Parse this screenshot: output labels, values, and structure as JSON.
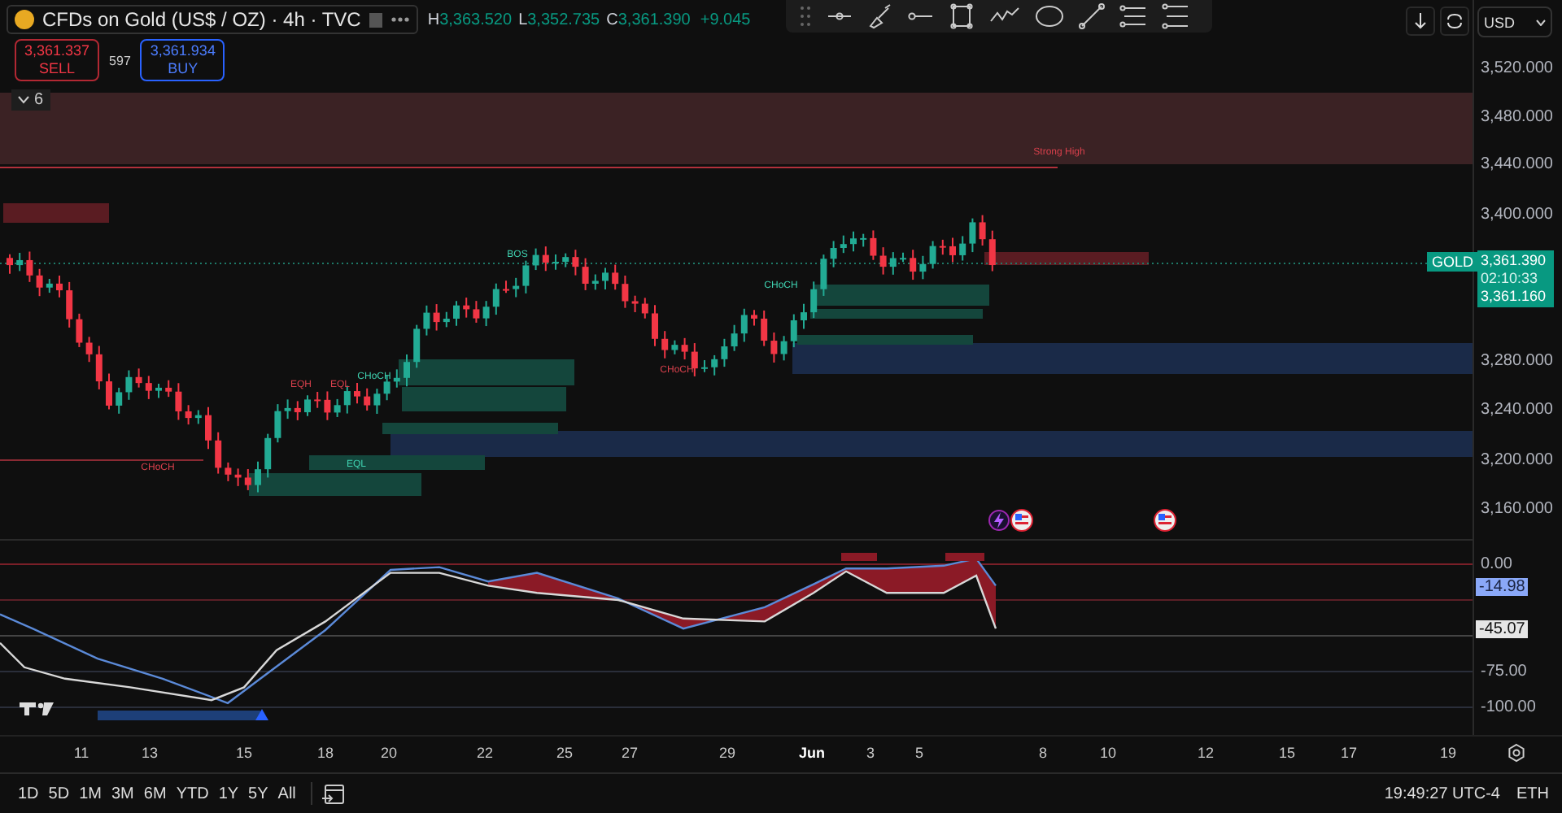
{
  "header": {
    "title": "CFDs on Gold (US$ / OZ) · 4h · TVC",
    "ohlc": [
      {
        "label": "H",
        "value": "3,363.520"
      },
      {
        "label": "L",
        "value": "3,352.735"
      },
      {
        "label": "C",
        "value": "3,361.390"
      }
    ],
    "change": "+9.045"
  },
  "trade": {
    "sell": {
      "price": "3,361.337",
      "label": "SELL"
    },
    "spread": "597",
    "buy": {
      "price": "3,361.934",
      "label": "BUY"
    }
  },
  "indicators_toggle": {
    "count": "6"
  },
  "currency": "USD",
  "chart_labels": [
    {
      "text": "Strong High",
      "kind": "bearish"
    },
    {
      "text": "BOS",
      "kind": "bullish"
    },
    {
      "text": "EQH",
      "kind": "bearish"
    },
    {
      "text": "EQL",
      "kind": "bearish"
    },
    {
      "text": "CHoCH",
      "kind": "bullish"
    },
    {
      "text": "CHoCH",
      "kind": "bearish"
    },
    {
      "text": "EQL",
      "kind": "bullish"
    },
    {
      "text": "CHoCH",
      "kind": "bearish"
    },
    {
      "text": "CHoCH",
      "kind": "bullish"
    }
  ],
  "price_axis": {
    "ticks": [
      "3,520.000",
      "3,480.000",
      "3,440.000",
      "3,400.000",
      "3,280.000",
      "3,240.000",
      "3,200.000",
      "3,160.000"
    ],
    "symbol_tag": "GOLD",
    "last_price": "3,361.390",
    "countdown": "02:10:33",
    "bid_price": "3,361.160"
  },
  "oscillator_axis": {
    "ticks": [
      "0.00",
      "-75.00",
      "-100.00"
    ],
    "badges": [
      {
        "text": "-14.98",
        "kind": "blue"
      },
      {
        "text": "-45.07",
        "kind": "white"
      }
    ]
  },
  "time_axis": {
    "ticks": [
      {
        "label": "11",
        "kind": "day"
      },
      {
        "label": "13",
        "kind": "day"
      },
      {
        "label": "15",
        "kind": "day"
      },
      {
        "label": "18",
        "kind": "day"
      },
      {
        "label": "20",
        "kind": "day"
      },
      {
        "label": "22",
        "kind": "day"
      },
      {
        "label": "25",
        "kind": "day"
      },
      {
        "label": "27",
        "kind": "day"
      },
      {
        "label": "29",
        "kind": "day"
      },
      {
        "label": "Jun",
        "kind": "month"
      },
      {
        "label": "3",
        "kind": "day"
      },
      {
        "label": "5",
        "kind": "day"
      },
      {
        "label": "8",
        "kind": "day"
      },
      {
        "label": "10",
        "kind": "day"
      },
      {
        "label": "12",
        "kind": "day"
      },
      {
        "label": "15",
        "kind": "day"
      },
      {
        "label": "17",
        "kind": "day"
      },
      {
        "label": "19",
        "kind": "day"
      }
    ]
  },
  "range_bar": {
    "ranges": [
      "1D",
      "5D",
      "1M",
      "3M",
      "6M",
      "YTD",
      "1Y",
      "5Y",
      "All"
    ],
    "time": "19:49:27 UTC-4",
    "session": "ETH"
  }
}
